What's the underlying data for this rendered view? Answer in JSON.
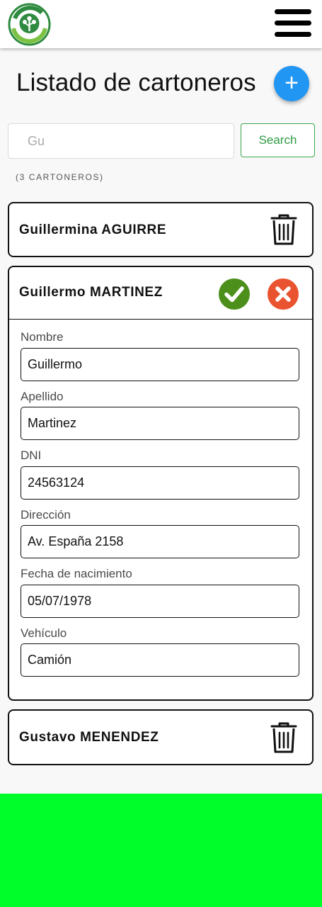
{
  "header": {
    "logo_icon": "recycling-tree-logo",
    "menu_icon": "hamburger-menu-icon"
  },
  "page": {
    "title": "Listado de cartoneros",
    "add_button": "+"
  },
  "search": {
    "value": "Gu",
    "button_label": "Search"
  },
  "count_text": "(3 CARTONEROS)",
  "cards": [
    {
      "name": "Guillermina AGUIRRE",
      "action_icon": "trash-icon"
    },
    {
      "name": "Guillermo MARTINEZ",
      "expanded": true,
      "confirm_icon": "check-circle-icon",
      "cancel_icon": "close-circle-icon",
      "fields": [
        {
          "label": "Nombre",
          "value": "Guillermo"
        },
        {
          "label": "Apellido",
          "value": "Martinez"
        },
        {
          "label": "DNI",
          "value": "24563124"
        },
        {
          "label": "Dirección",
          "value": "Av. España 2158"
        },
        {
          "label": "Fecha de nacimiento",
          "value": "05/07/1978"
        },
        {
          "label": "Vehículo",
          "value": "Camión"
        }
      ]
    },
    {
      "name": "Gustavo MENENDEZ",
      "action_icon": "trash-icon"
    }
  ],
  "colors": {
    "primary_blue": "#2196f3",
    "green": "#3aa54b",
    "confirm_green": "#4c8f1b",
    "cancel_orange": "#e9532f",
    "footer_green": "#00ff2a"
  }
}
